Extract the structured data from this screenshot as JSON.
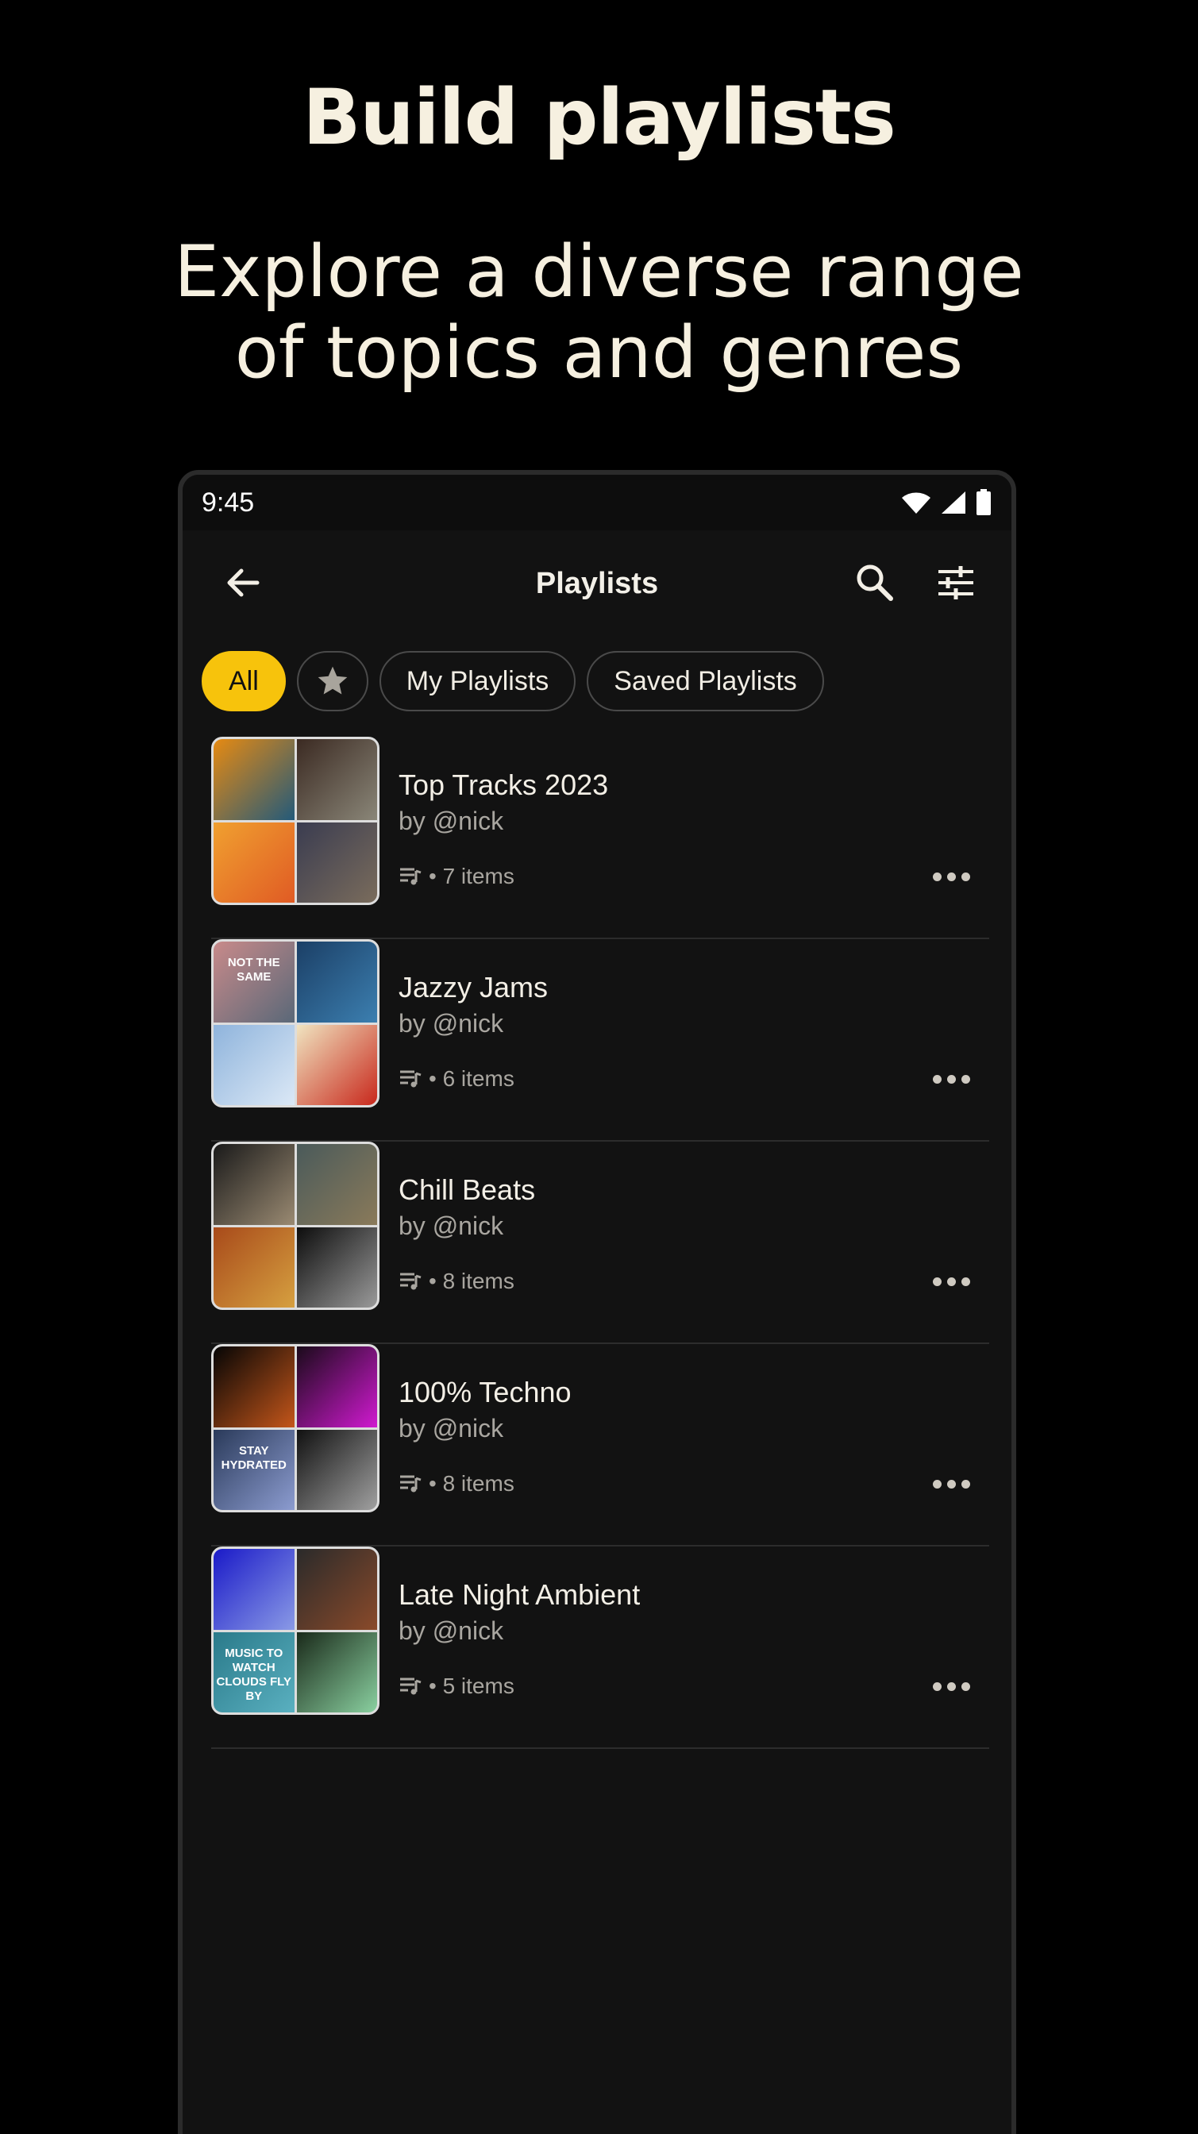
{
  "hero": {
    "title": "Build playlists",
    "subtitle_line1": "Explore a diverse range",
    "subtitle_line2": "of topics and genres"
  },
  "status_bar": {
    "time": "9:45",
    "icons": [
      "wifi-icon",
      "signal-icon",
      "battery-icon"
    ]
  },
  "app_bar": {
    "title": "Playlists",
    "icons": [
      "back-arrow-icon",
      "search-icon",
      "filter-sliders-icon"
    ]
  },
  "filters": {
    "all": "All",
    "starred_icon": "star-icon",
    "my_playlists": "My Playlists",
    "saved_playlists": "Saved Playlists"
  },
  "playlists": [
    {
      "title": "Top Tracks 2023",
      "author": "by @nick",
      "count": "• 7 items",
      "tiles": [
        {
          "c1": "#e68a12",
          "c2": "#235a7a",
          "text": ""
        },
        {
          "c1": "#3b2a22",
          "c2": "#8a8678",
          "text": ""
        },
        {
          "c1": "#f0a030",
          "c2": "#e05b24",
          "text": ""
        },
        {
          "c1": "#3a3c50",
          "c2": "#7a6c5c",
          "text": ""
        }
      ]
    },
    {
      "title": "Jazzy Jams",
      "author": "by @nick",
      "count": "• 6 items",
      "tiles": [
        {
          "c1": "#c88a8a",
          "c2": "#5a6878",
          "text": "NOT THE SAME"
        },
        {
          "c1": "#1b3f66",
          "c2": "#3c7fb0",
          "text": ""
        },
        {
          "c1": "#8fb4dc",
          "c2": "#dbe8f6",
          "text": ""
        },
        {
          "c1": "#f0e4c0",
          "c2": "#c8281c",
          "text": ""
        }
      ]
    },
    {
      "title": "Chill Beats",
      "author": "by @nick",
      "count": "• 8 items",
      "tiles": [
        {
          "c1": "#1a1a1a",
          "c2": "#9a8a72",
          "text": ""
        },
        {
          "c1": "#4a5a5a",
          "c2": "#8a7a5a",
          "text": ""
        },
        {
          "c1": "#a84a1a",
          "c2": "#d6a040",
          "text": ""
        },
        {
          "c1": "#0d0d0d",
          "c2": "#9a9a9a",
          "text": ""
        }
      ]
    },
    {
      "title": "100% Techno",
      "author": "by @nick",
      "count": "• 8 items",
      "tiles": [
        {
          "c1": "#050505",
          "c2": "#c4561a",
          "text": ""
        },
        {
          "c1": "#1a0a1a",
          "c2": "#d01ad0",
          "text": ""
        },
        {
          "c1": "#2a3a5a",
          "c2": "#8c9cd0",
          "text": "STAY HYDRATED"
        },
        {
          "c1": "#111111",
          "c2": "#a0a0a0",
          "text": ""
        }
      ]
    },
    {
      "title": "Late Night Ambient",
      "author": "by @nick",
      "count": "• 5 items",
      "tiles": [
        {
          "c1": "#1a1ac8",
          "c2": "#8a9ae6",
          "text": ""
        },
        {
          "c1": "#2a2a2a",
          "c2": "#8a4a2a",
          "text": ""
        },
        {
          "c1": "#2a7a8a",
          "c2": "#5ab0c0",
          "text": "MUSIC TO WATCH CLOUDS FLY BY"
        },
        {
          "c1": "#1a2a1a",
          "c2": "#8ad0a0",
          "text": ""
        }
      ]
    }
  ]
}
